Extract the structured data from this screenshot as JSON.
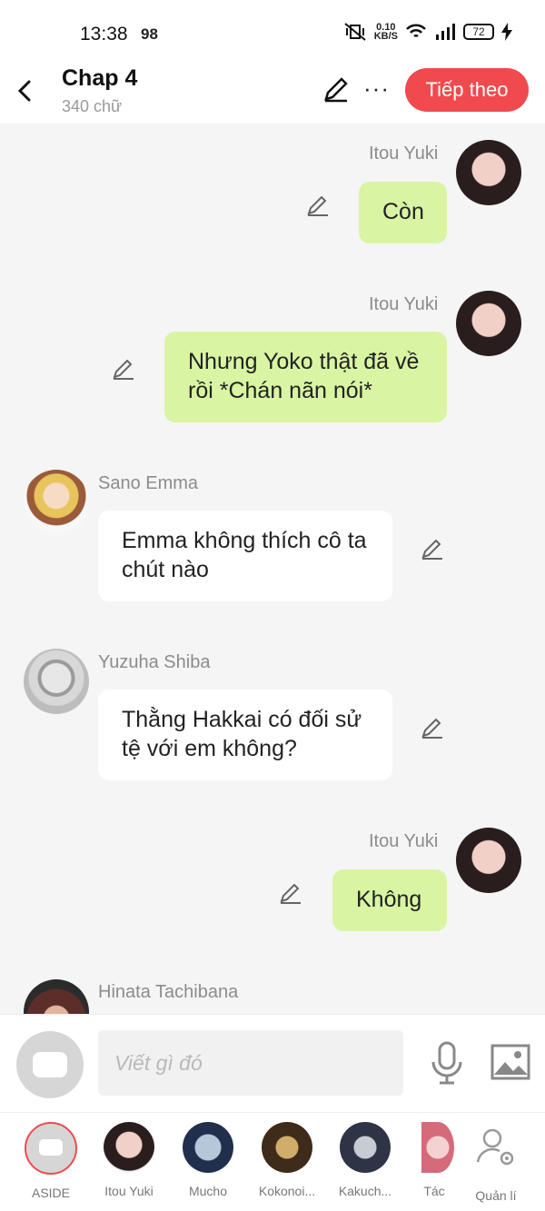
{
  "status_bar": {
    "time": "13:38",
    "number": "98",
    "net_speed_value": "0.10",
    "net_speed_unit": "KB/S",
    "battery": "72"
  },
  "header": {
    "title": "Chap 4",
    "subtitle": "340 chữ",
    "next_button": "Tiếp theo"
  },
  "messages": [
    {
      "sender": "Itou Yuki",
      "side": "right",
      "text": "Còn"
    },
    {
      "sender": "Itou Yuki",
      "side": "right",
      "text": "Nhưng Yoko thật đã về rồi *Chán nãn nói*"
    },
    {
      "sender": "Sano Emma",
      "side": "left",
      "text": "Emma không thích cô ta chút nào"
    },
    {
      "sender": "Yuzuha Shiba",
      "side": "left",
      "text": "Thằng Hakkai có đối sử tệ với em không?"
    },
    {
      "sender": "Itou Yuki",
      "side": "right",
      "text": "Không"
    },
    {
      "sender": "Hinata Tachibana",
      "side": "left",
      "text": ""
    }
  ],
  "input": {
    "placeholder": "Viết gì đó"
  },
  "bottom_nav": {
    "items": [
      {
        "label": "ASIDE"
      },
      {
        "label": "Itou Yuki"
      },
      {
        "label": "Mucho"
      },
      {
        "label": "Kokonoi..."
      },
      {
        "label": "Kakuch..."
      },
      {
        "label": "Tác"
      },
      {
        "label": "Quản lí"
      }
    ]
  },
  "colors": {
    "accent": "#f04a4f",
    "bubble_green": "#d9f5a4",
    "bubble_white": "#ffffff",
    "background": "#f5f5f5"
  },
  "icons": [
    "back-arrow-icon",
    "pencil-icon",
    "more-icon",
    "mic-icon",
    "image-icon",
    "settings-user-icon"
  ]
}
